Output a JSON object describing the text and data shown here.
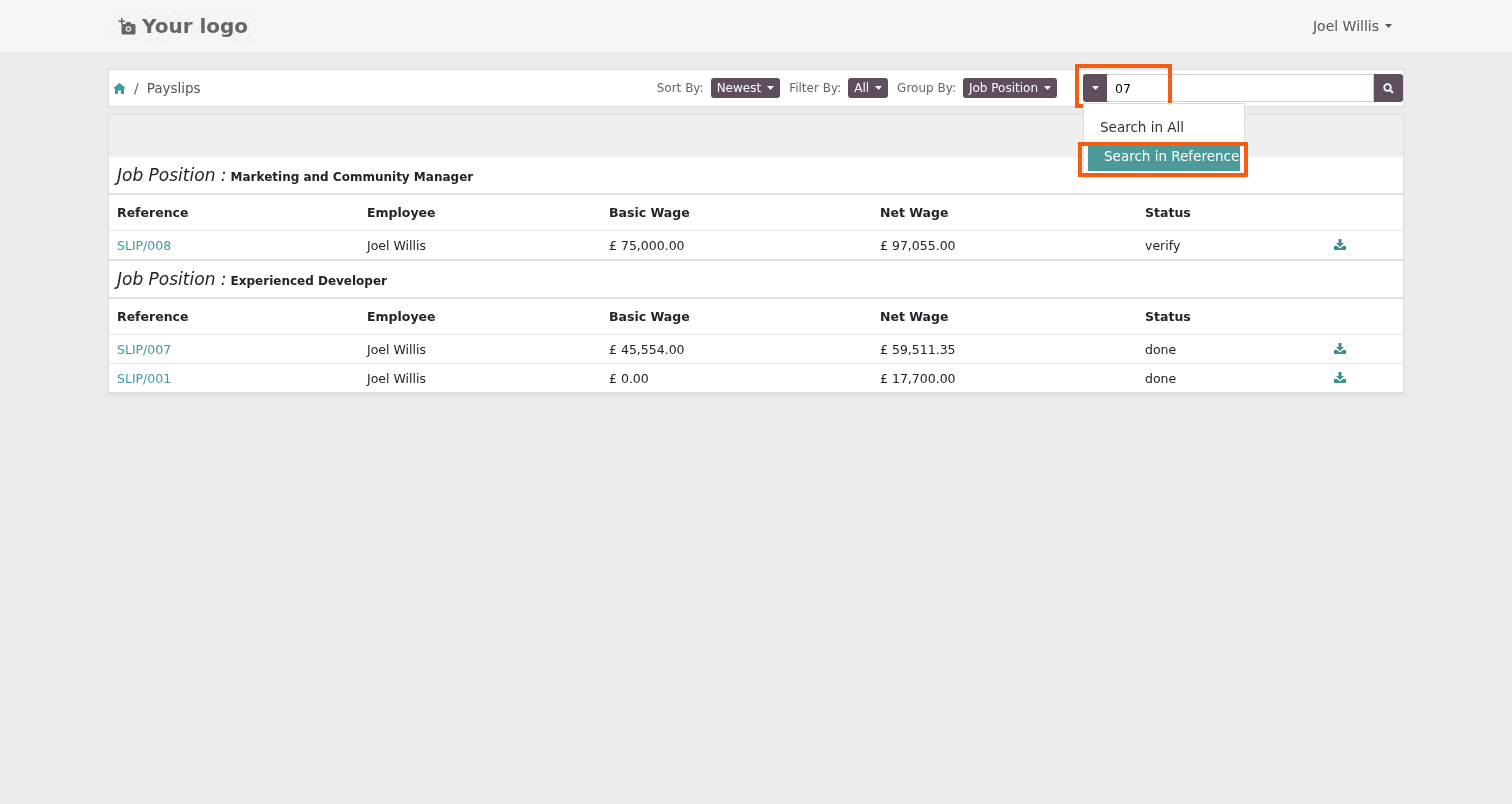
{
  "header": {
    "logo": "Your logo",
    "user": "Joel Willis"
  },
  "breadcrumb": {
    "separator": "/",
    "current": "Payslips"
  },
  "toolbar": {
    "controls": [
      {
        "label": "Sort By:",
        "value": "Newest"
      },
      {
        "label": "Filter By:",
        "value": "All"
      },
      {
        "label": "Group By:",
        "value": "Job Position"
      }
    ],
    "search": {
      "value": "07",
      "highlighted": true,
      "menu": [
        {
          "label": "Search in All",
          "selected": false,
          "highlighted": false
        },
        {
          "label": "Search in Reference",
          "selected": true,
          "highlighted": true
        }
      ]
    }
  },
  "groups": [
    {
      "label": "Job Position :",
      "value": "Marketing and Community Manager",
      "columns": [
        "Reference",
        "Employee",
        "Basic Wage",
        "Net Wage",
        "Status"
      ],
      "rows": [
        {
          "reference": "SLIP/008",
          "employee": "Joel Willis",
          "basic_wage": "£ 75,000.00",
          "net_wage": "£ 97,055.00",
          "status": "verify"
        }
      ]
    },
    {
      "label": "Job Position :",
      "value": "Experienced Developer",
      "columns": [
        "Reference",
        "Employee",
        "Basic Wage",
        "Net Wage",
        "Status"
      ],
      "rows": [
        {
          "reference": "SLIP/007",
          "employee": "Joel Willis",
          "basic_wage": "£ 45,554.00",
          "net_wage": "£ 59,511.35",
          "status": "done"
        },
        {
          "reference": "SLIP/001",
          "employee": "Joel Willis",
          "basic_wage": "£ 0.00",
          "net_wage": "£ 17,700.00",
          "status": "done"
        }
      ]
    }
  ]
}
